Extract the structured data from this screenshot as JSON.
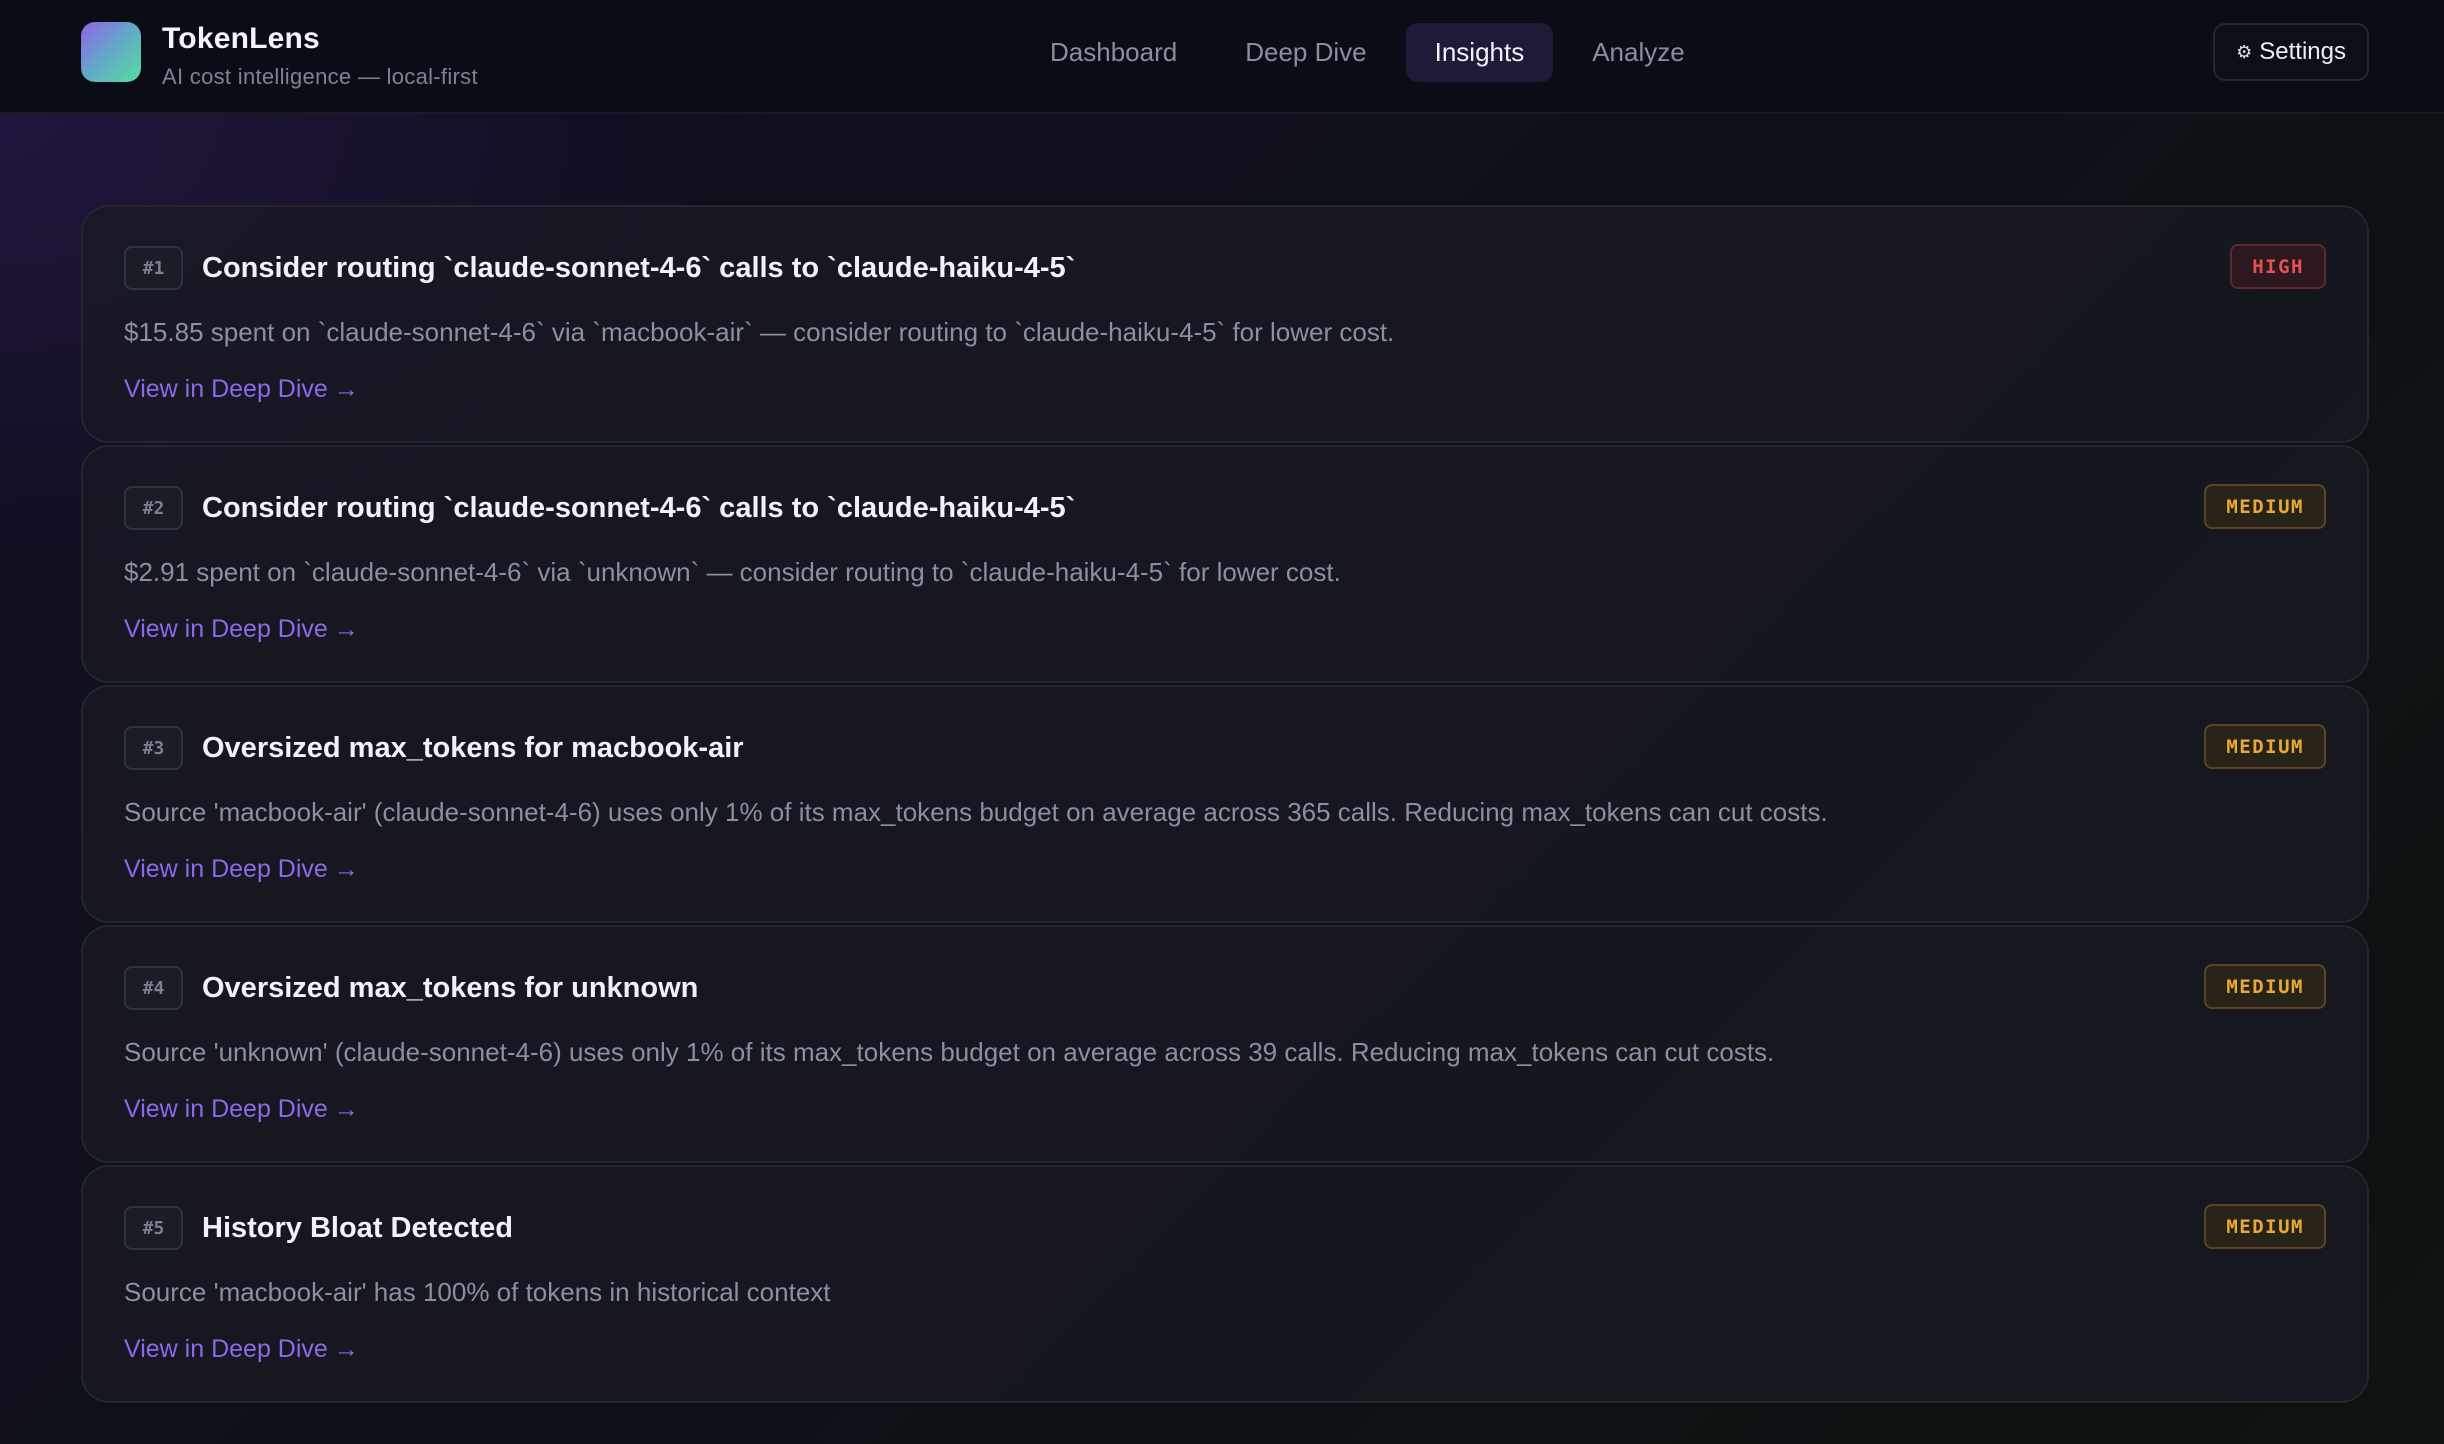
{
  "app": {
    "name": "TokenLens",
    "tagline": "AI cost intelligence — local-first"
  },
  "nav": {
    "tabs": [
      {
        "label": "Dashboard",
        "active": false
      },
      {
        "label": "Deep Dive",
        "active": false
      },
      {
        "label": "Insights",
        "active": true
      },
      {
        "label": "Analyze",
        "active": false
      }
    ],
    "settings_icon": "gear-icon",
    "settings_label": "Settings"
  },
  "colors": {
    "accent": "#8f68e8",
    "high": "#e2524f",
    "medium": "#e6a93d"
  },
  "insights": [
    {
      "rank": "#1",
      "title": "Consider routing `claude-sonnet-4-6` calls to `claude-haiku-4-5`",
      "severity": "HIGH",
      "description": "$15.85 spent on `claude-sonnet-4-6` via `macbook-air` — consider routing to `claude-haiku-4-5` for lower cost.",
      "link": "View in Deep Dive"
    },
    {
      "rank": "#2",
      "title": "Consider routing `claude-sonnet-4-6` calls to `claude-haiku-4-5`",
      "severity": "MEDIUM",
      "description": "$2.91 spent on `claude-sonnet-4-6` via `unknown` — consider routing to `claude-haiku-4-5` for lower cost.",
      "link": "View in Deep Dive"
    },
    {
      "rank": "#3",
      "title": "Oversized max_tokens for macbook-air",
      "severity": "MEDIUM",
      "description": "Source 'macbook-air' (claude-sonnet-4-6) uses only 1% of its max_tokens budget on average across 365 calls. Reducing max_tokens can cut costs.",
      "link": "View in Deep Dive"
    },
    {
      "rank": "#4",
      "title": "Oversized max_tokens for unknown",
      "severity": "MEDIUM",
      "description": "Source 'unknown' (claude-sonnet-4-6) uses only 1% of its max_tokens budget on average across 39 calls. Reducing max_tokens can cut costs.",
      "link": "View in Deep Dive"
    },
    {
      "rank": "#5",
      "title": "History Bloat Detected",
      "severity": "MEDIUM",
      "description": "Source 'macbook-air' has 100% of tokens in historical context",
      "link": "View in Deep Dive"
    }
  ]
}
